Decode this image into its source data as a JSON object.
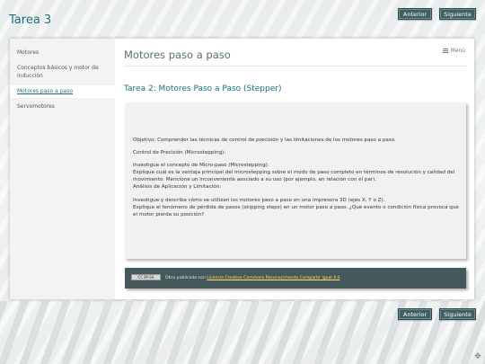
{
  "header": {
    "title": "Tarea 3",
    "prev_label": "Anterior",
    "next_label": "Siguiente"
  },
  "sidebar": {
    "items": [
      {
        "label": "Motores"
      },
      {
        "label": "Conceptos básicos y motor de inducción"
      },
      {
        "label": "Motores paso a paso"
      },
      {
        "label": "Servomotores"
      }
    ],
    "active_index": 2
  },
  "main": {
    "page_title": "Motores paso a paso",
    "menu_label": "Menú",
    "task_title": "Tarea 2: Motores Paso a Paso (Stepper)",
    "paragraphs": [
      "Objetivo: Comprender las técnicas de control de precisión y las limitaciones de los motores paso a paso.",
      "Control de Precisión (Microstepping):",
      "Investigue el concepto de Micro-paso (Microstepping).",
      "Explique cuál es la ventaja principal del microstepping sobre el modo de paso completo en términos de resolución y calidad del movimiento. Mencione un inconveniente asociado a su uso (por ejemplo, en relación con el par).",
      "Análisis de Aplicación y Limitación:",
      "Investigue y describa cómo se utilizan los motores paso a paso en una impresora 3D (ejes X, Y o Z).",
      "Explique el fenómeno de pérdida de pasos (skipping steps) en un motor paso a paso. ¿Qué evento o condición física provoca que el motor pierda su posición?"
    ]
  },
  "license": {
    "badge_text": "CC BY-SA",
    "prefix": "Obra publicada con",
    "link_text": "Licencia Creative Commons Reconocimiento Compartir igual 4.0"
  },
  "footer": {
    "prev_label": "Anterior",
    "next_label": "Siguiente"
  },
  "colors": {
    "accent": "#1f6f7d",
    "button_bg": "#3f5f62",
    "license_bg": "#45585a"
  },
  "icons": {
    "menu": "hamburger-icon",
    "corner": "resize-grip-icon"
  }
}
